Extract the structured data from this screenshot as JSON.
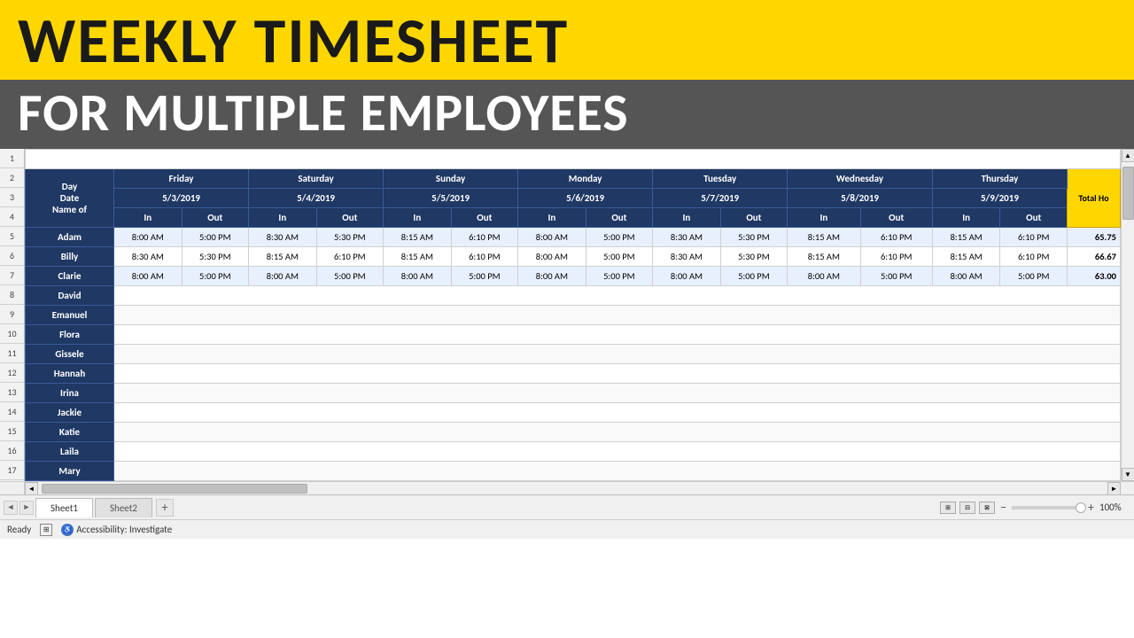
{
  "title": "WEEKLY TIMESHEET",
  "subtitle": "FOR MULTIPLE EMPLOYEES",
  "header": {
    "rows": {
      "row2": {
        "day": "Day",
        "friday": "Friday",
        "saturday": "Saturday",
        "sunday": "Sunday",
        "monday": "Monday",
        "tuesday": "Tuesday",
        "wednesday": "Wednesday",
        "thursday": "Thursday",
        "total": "Total Ho"
      },
      "row3": {
        "date": "Date",
        "fri_date": "5/3/2019",
        "sat_date": "5/4/2019",
        "sun_date": "5/5/2019",
        "mon_date": "5/6/2019",
        "tue_date": "5/7/2019",
        "wed_date": "5/8/2019",
        "thu_date": "5/9/2019"
      },
      "row4": {
        "name_of": "Name of",
        "in": "In",
        "out": "Out"
      }
    }
  },
  "employees": [
    {
      "name": "Adam",
      "fri_in": "8:00 AM",
      "fri_out": "5:00 PM",
      "sat_in": "8:30 AM",
      "sat_out": "5:30 PM",
      "sun_in": "8:15 AM",
      "sun_out": "6:10 PM",
      "mon_in": "8:00 AM",
      "mon_out": "5:00 PM",
      "tue_in": "8:30 AM",
      "tue_out": "5:30 PM",
      "wed_in": "8:15 AM",
      "wed_out": "6:10 PM",
      "thu_in": "8:15 AM",
      "thu_out": "6:10 PM",
      "total": "65.75"
    },
    {
      "name": "Billy",
      "fri_in": "8:30 AM",
      "fri_out": "5:30 PM",
      "sat_in": "8:15 AM",
      "sat_out": "6:10 PM",
      "sun_in": "8:15 AM",
      "sun_out": "6:10 PM",
      "mon_in": "8:00 AM",
      "mon_out": "5:00 PM",
      "tue_in": "8:30 AM",
      "tue_out": "5:30 PM",
      "wed_in": "8:15 AM",
      "wed_out": "6:10 PM",
      "thu_in": "8:15 AM",
      "thu_out": "6:10 PM",
      "total": "66.67"
    },
    {
      "name": "Clarie",
      "fri_in": "8:00 AM",
      "fri_out": "5:00 PM",
      "sat_in": "8:00 AM",
      "sat_out": "5:00 PM",
      "sun_in": "8:00 AM",
      "sun_out": "5:00 PM",
      "mon_in": "8:00 AM",
      "mon_out": "5:00 PM",
      "tue_in": "8:00 AM",
      "tue_out": "5:00 PM",
      "wed_in": "8:00 AM",
      "wed_out": "5:00 PM",
      "thu_in": "8:00 AM",
      "thu_out": "5:00 PM",
      "total": "63.00"
    },
    {
      "name": "David"
    },
    {
      "name": "Emanuel"
    },
    {
      "name": "Flora"
    },
    {
      "name": "Gissele"
    },
    {
      "name": "Hannah"
    },
    {
      "name": "Irina"
    },
    {
      "name": "Jackie"
    },
    {
      "name": "Katie"
    },
    {
      "name": "Laila"
    },
    {
      "name": "Mary"
    }
  ],
  "row_numbers": [
    1,
    2,
    3,
    4,
    5,
    6,
    7,
    8,
    9,
    10,
    11,
    12,
    13,
    14,
    15,
    16,
    17
  ],
  "tabs": [
    "Sheet1",
    "Sheet2"
  ],
  "active_tab": "Sheet1",
  "status": {
    "ready": "Ready",
    "zoom": "100%",
    "accessibility": "Accessibility: Investigate"
  }
}
